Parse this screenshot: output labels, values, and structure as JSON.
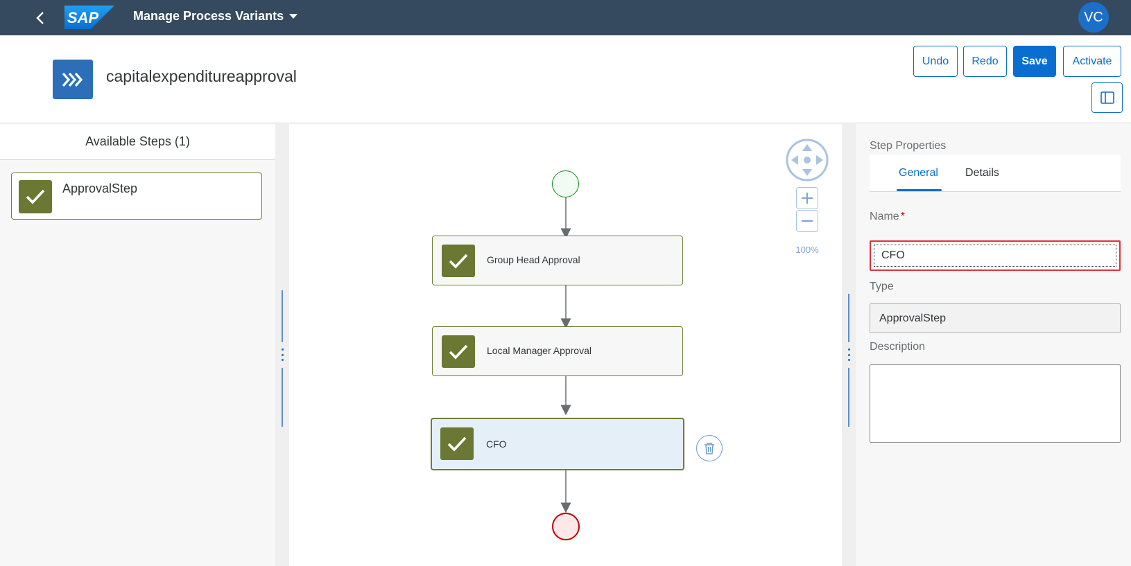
{
  "shell": {
    "app_title": "Manage Process Variants",
    "logo_text": "SAP",
    "user_initials": "VC"
  },
  "header": {
    "process_name": "capitalexpenditureapproval",
    "buttons": {
      "undo": "Undo",
      "redo": "Redo",
      "save": "Save",
      "activate": "Activate"
    }
  },
  "available_steps": {
    "title": "Available Steps (1)",
    "items": [
      {
        "label": "ApprovalStep",
        "icon": "checkmark-icon"
      }
    ]
  },
  "canvas": {
    "steps": [
      {
        "label": "Group Head Approval",
        "selected": false
      },
      {
        "label": "Local Manager Approval",
        "selected": false
      },
      {
        "label": "CFO",
        "selected": true
      }
    ],
    "zoom_level": "100%"
  },
  "properties": {
    "title": "Step Properties",
    "tabs": [
      {
        "label": "General",
        "active": true
      },
      {
        "label": "Details",
        "active": false
      }
    ],
    "name_label": "Name",
    "name_required_marker": "*",
    "name_value": "CFO",
    "type_label": "Type",
    "type_value": "ApprovalStep",
    "description_label": "Description",
    "description_value": ""
  },
  "colors": {
    "shell_bg": "#354a5f",
    "accent": "#0a6ed1",
    "step_green": "#6a7834",
    "start_event": "#188918",
    "end_event": "#bb0000",
    "selected_step_bg": "#e5eff8"
  }
}
